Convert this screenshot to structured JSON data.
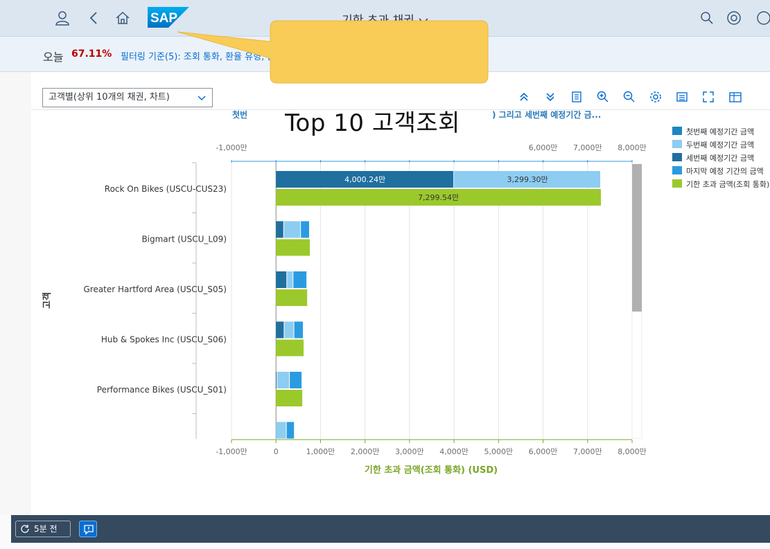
{
  "shell": {
    "title": "기한 초과 채권",
    "logo_text": "SAP"
  },
  "filterbar": {
    "today_label": "오늘",
    "today_value": "67.11%",
    "filter_text": "필터링 기준(5): 조회 통화, 환율 유형, 순액 만기 간격 3, 순액 만기 간격 1, 순액 만기 간격 2"
  },
  "toolbar": {
    "view_select_value": "고객별(상위 10개의 채권, 차트)"
  },
  "annotation": {
    "callout_text": "Top 10 고객조회"
  },
  "footer": {
    "refresh_label": "5분 전"
  },
  "colors": {
    "series1": "#1b86c3",
    "series2": "#8dcdf2",
    "series3": "#1f6f9f",
    "series4": "#2b9be1",
    "total": "#9bc92b",
    "accent": "#0a6ed1",
    "today_value": "#bb0000",
    "callout": "#f8cc57"
  },
  "chart_data": {
    "type": "bar",
    "orientation": "horizontal",
    "title_left": "첫번",
    "title_right": ") 그리고 세번째 예정기간 금...",
    "xlabel": "기한 초과 금액(조회 통화) (USD)",
    "ylabel": "고객",
    "xlim": [
      -1000,
      8000
    ],
    "x_ticks": [
      "-1,000만",
      "0",
      "1,000만",
      "2,000만",
      "3,000만",
      "4,000만",
      "5,000만",
      "6,000만",
      "7,000만",
      "8,000만"
    ],
    "top_ticks": [
      "-1,000만",
      "6,000만",
      "7,000만",
      "8,000만"
    ],
    "categories": [
      "Rock On Bikes (USCU-CUS23)",
      "Bigmart (USCU_L09)",
      "Greater Hartford Area (USCU_S05)",
      "Hub & Spokes Inc (USCU_S06)",
      "Performance Bikes (USCU_S01)",
      ""
    ],
    "series": [
      {
        "name": "첫번째 예정기간 금액",
        "values": [
          0,
          0,
          0,
          0,
          0,
          0
        ]
      },
      {
        "name": "두번째 예정기간 금액",
        "values": [
          3299.3,
          380,
          140,
          220,
          280,
          240
        ]
      },
      {
        "name": "세번째 예정기간 금액",
        "values": [
          4000.24,
          180,
          250,
          190,
          30,
          0
        ]
      },
      {
        "name": "마지막 예정 기간의 금액",
        "values": [
          0,
          200,
          310,
          210,
          280,
          180
        ]
      },
      {
        "name": "기한 초과 금액(조회 통화)",
        "values": [
          7299.54,
          760,
          700,
          620,
          590,
          null
        ]
      }
    ],
    "data_labels": {
      "series3_row0": "4,000.24만",
      "series2_row0": "3,299.30만",
      "total_row0": "7,299.54만"
    },
    "legend_position": "right",
    "grid": true
  }
}
